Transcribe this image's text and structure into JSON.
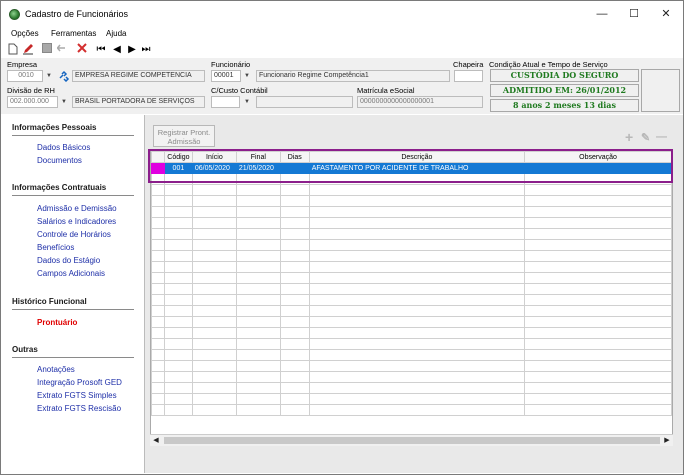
{
  "window": {
    "title": "Cadastro de Funcionários",
    "minimize": "—",
    "maximize": "☐",
    "close": "✕"
  },
  "menu": [
    "Opções",
    "Ferramentas",
    "Ajuda"
  ],
  "toolbar": {
    "new": "new-icon",
    "edit": "edit-icon",
    "save": "save-icon",
    "undo": "undo-icon",
    "delete": "delete-icon",
    "first": "⏮",
    "prev": "◀",
    "next": "▶",
    "last": "⏭"
  },
  "header": {
    "empresa_label": "Empresa",
    "empresa_code": "0010",
    "empresa_name": "EMPRESA REGIME COMPETENCIA",
    "funcionario_label": "Funcionário",
    "funcionario_code": "00001",
    "funcionario_name": "Funcionario Regime Competência1",
    "chapeira_label": "Chapeira",
    "chapeira_value": "",
    "condicao_label": "Condição Atual e Tempo de Serviço",
    "status": "CUSTÓDIA DO SEGURO",
    "admitido": "ADMITIDO EM: 26/01/2012",
    "tempo": "8 anos 2 meses 13 dias",
    "divisao_label": "Divisão de RH",
    "divisao_code": "002.000.000",
    "divisao_name": "BRASIL PORTADORA DE SERVIÇOS",
    "custo_label": "C/Custo Contábil",
    "custo_code": "",
    "custo_name": "",
    "matricula_label": "Matrícula eSocial",
    "matricula_value": "0000000000000000001"
  },
  "sidebar": {
    "s1": "Informações Pessoais",
    "s1_items": [
      "Dados Básicos",
      "Documentos"
    ],
    "s2": "Informações Contratuais",
    "s2_items": [
      "Admissão e Demissão",
      "Salários e Indicadores",
      "Controle de Horários",
      "Benefícios",
      "Dados do Estágio",
      "Campos Adicionais"
    ],
    "s3": "Histórico Funcional",
    "s3_items": [
      "Prontuário"
    ],
    "s4": "Outras",
    "s4_items": [
      "Anotações",
      "Integração Prosoft GED",
      "Extrato FGTS Simples",
      "Extrato FGTS Rescisão"
    ]
  },
  "main": {
    "register_button": "Registrar Pront. Admissão",
    "add_icon": "+",
    "edit_icon": "✎",
    "remove_icon": "—",
    "columns": [
      "Código",
      "Início",
      "Final",
      "Dias",
      "Descrição",
      "Observação"
    ],
    "rows": [
      {
        "codigo": "001",
        "inicio": "06/05/2020",
        "final": "21/05/2020",
        "dias": "",
        "descricao": "AFASTAMENTO POR ACIDENTE DE TRABALHO",
        "observacao": ""
      }
    ],
    "scroll_left": "◀",
    "scroll_right": "▶"
  },
  "colors": {
    "selection": "#1479d4",
    "indicator": "#e000e0",
    "highlight": "#8b1e8b",
    "status_text": "#1f7a1f",
    "active_link": "#e00000",
    "link": "#1e2fa8"
  }
}
